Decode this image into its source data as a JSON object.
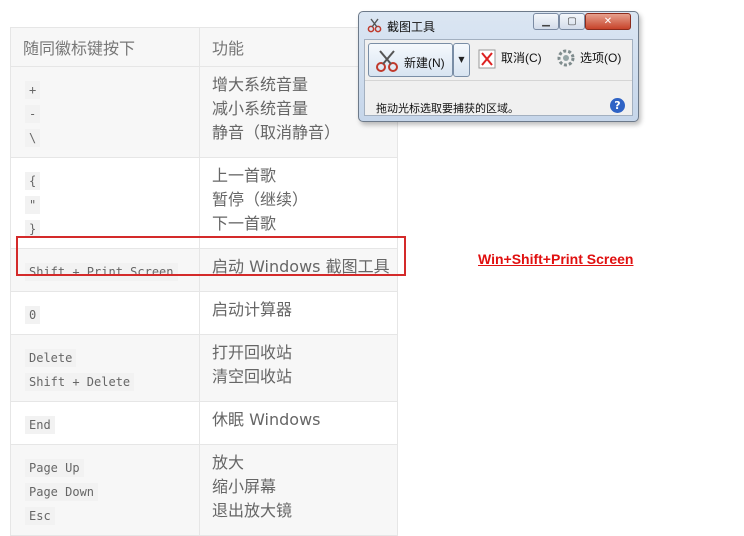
{
  "table": {
    "header": {
      "keys": "随同徽标键按下",
      "func": "功能"
    },
    "groups": [
      {
        "keys": [
          "+",
          "-",
          "\\"
        ],
        "funcs": [
          "增大系统音量",
          "减小系统音量",
          "静音（取消静音）"
        ]
      },
      {
        "keys": [
          "{",
          "\"",
          "}"
        ],
        "funcs": [
          "上一首歌",
          "暂停（继续）",
          "下一首歌"
        ]
      },
      {
        "keys": [
          "Shift + Print Screen"
        ],
        "funcs": [
          "启动 Windows 截图工具"
        ]
      },
      {
        "keys": [
          "0"
        ],
        "funcs": [
          "启动计算器"
        ]
      },
      {
        "keys": [
          "Delete",
          "Shift + Delete"
        ],
        "funcs": [
          "打开回收站",
          "清空回收站"
        ]
      },
      {
        "keys": [
          "End"
        ],
        "funcs": [
          "休眠 Windows"
        ]
      },
      {
        "keys": [
          "Page Up",
          "Page Down",
          "Esc"
        ],
        "funcs": [
          "放大",
          "缩小屏幕",
          "退出放大镜"
        ]
      }
    ]
  },
  "annotation": "Win+Shift+Print Screen",
  "snip_window": {
    "title": "截图工具",
    "new_button": "新建(N)",
    "cancel_button": "取消(C)",
    "options_button": "选项(O)",
    "hint": "拖动光标选取要捕获的区域。",
    "help": "?"
  },
  "colors": {
    "highlight": "#d42a2a",
    "annotation": "#e01010"
  },
  "icons": [
    "scissors-icon",
    "chevron-down-icon",
    "cancel-icon",
    "gear-icon",
    "help-icon",
    "minimize-icon",
    "maximize-icon",
    "close-icon"
  ]
}
